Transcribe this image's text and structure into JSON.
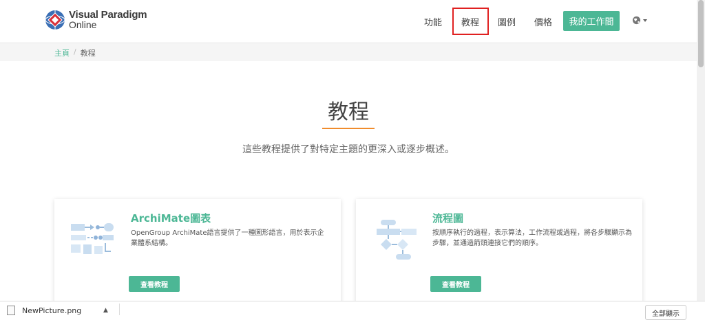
{
  "header": {
    "logo_line1": "Visual Paradigm",
    "logo_line2": "Online",
    "nav": [
      "功能",
      "教程",
      "圖例",
      "價格"
    ],
    "active_nav": "教程",
    "cta_label": "我的工作間",
    "language_icon": "globe-icon",
    "accent_color": "#4cb795",
    "highlight_color": "#e02020"
  },
  "breadcrumb": {
    "home": "主頁",
    "separator": "/",
    "current": "教程"
  },
  "hero": {
    "title": "教程",
    "subtitle": "這些教程提供了對特定主題的更深入或逐步概述。",
    "rule_color": "#f08c2c"
  },
  "cards": [
    {
      "title": "ArchiMate圖表",
      "description": "OpenGroup ArchiMate語言提供了一種圖形語言，用於表示企業體系結構。",
      "button": "查看教程",
      "thumb_icon": "archimate-diagram-icon"
    },
    {
      "title": "流程圖",
      "description": "按順序執行的過程，表示算法，工作流程或過程，將各步驟顯示為步驟，並通過箭頭連接它們的順序。",
      "button": "查看教程",
      "thumb_icon": "flowchart-diagram-icon"
    }
  ],
  "download_bar": {
    "file_name": "NewPicture.png",
    "show_all": "全部顯示"
  }
}
